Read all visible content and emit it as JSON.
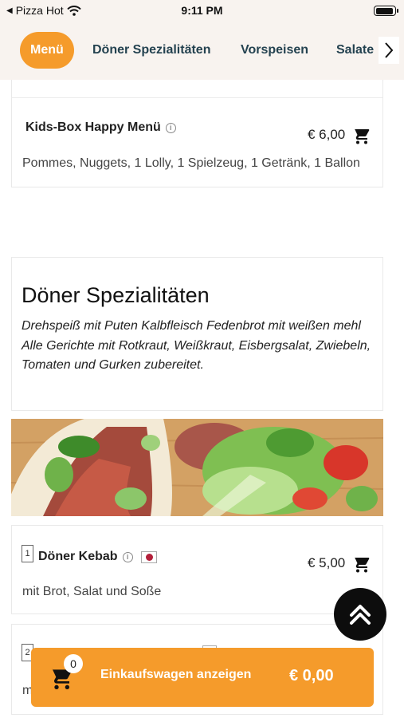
{
  "status_bar": {
    "back_app": "Pizza Hot",
    "time": "9:11 PM"
  },
  "category_nav": {
    "tabs": [
      {
        "label": "Menü",
        "active": true
      },
      {
        "label": "Döner Spezialitäten",
        "active": false
      },
      {
        "label": "Vorspeisen",
        "active": false
      },
      {
        "label": "Salate",
        "active": false
      }
    ],
    "next_icon": "chevron-right-icon"
  },
  "items": {
    "kids_box": {
      "title": "Kids-Box Happy Menü",
      "price": "€ 6,00",
      "description": "Pommes, Nuggets, 1 Lolly, 1 Spielzeug, 1 Getränk, 1 Ballon"
    },
    "doener_kebab": {
      "number": "1",
      "title": "Döner Kebab",
      "price": "€ 5,00",
      "description": "mit Brot, Salat und Soße"
    },
    "partial_next": {
      "number": "2",
      "description_fragment": "m"
    }
  },
  "section": {
    "title": "Döner Spezialitäten",
    "description": "Drehspeiß mit Puten Kalbfleisch Fedenbrot mit weißen mehl Alle Gerichte mit Rotkraut, Weißkraut, Eisbergsalat, Zwiebeln, Tomaten und Gurken zubereitet."
  },
  "cart": {
    "count": "0",
    "label": "Einkaufswagen anzeigen",
    "total": "€ 0,00"
  },
  "colors": {
    "accent": "#f59b2b",
    "nav_text": "#244250",
    "nav_background": "#f8f3ef"
  }
}
